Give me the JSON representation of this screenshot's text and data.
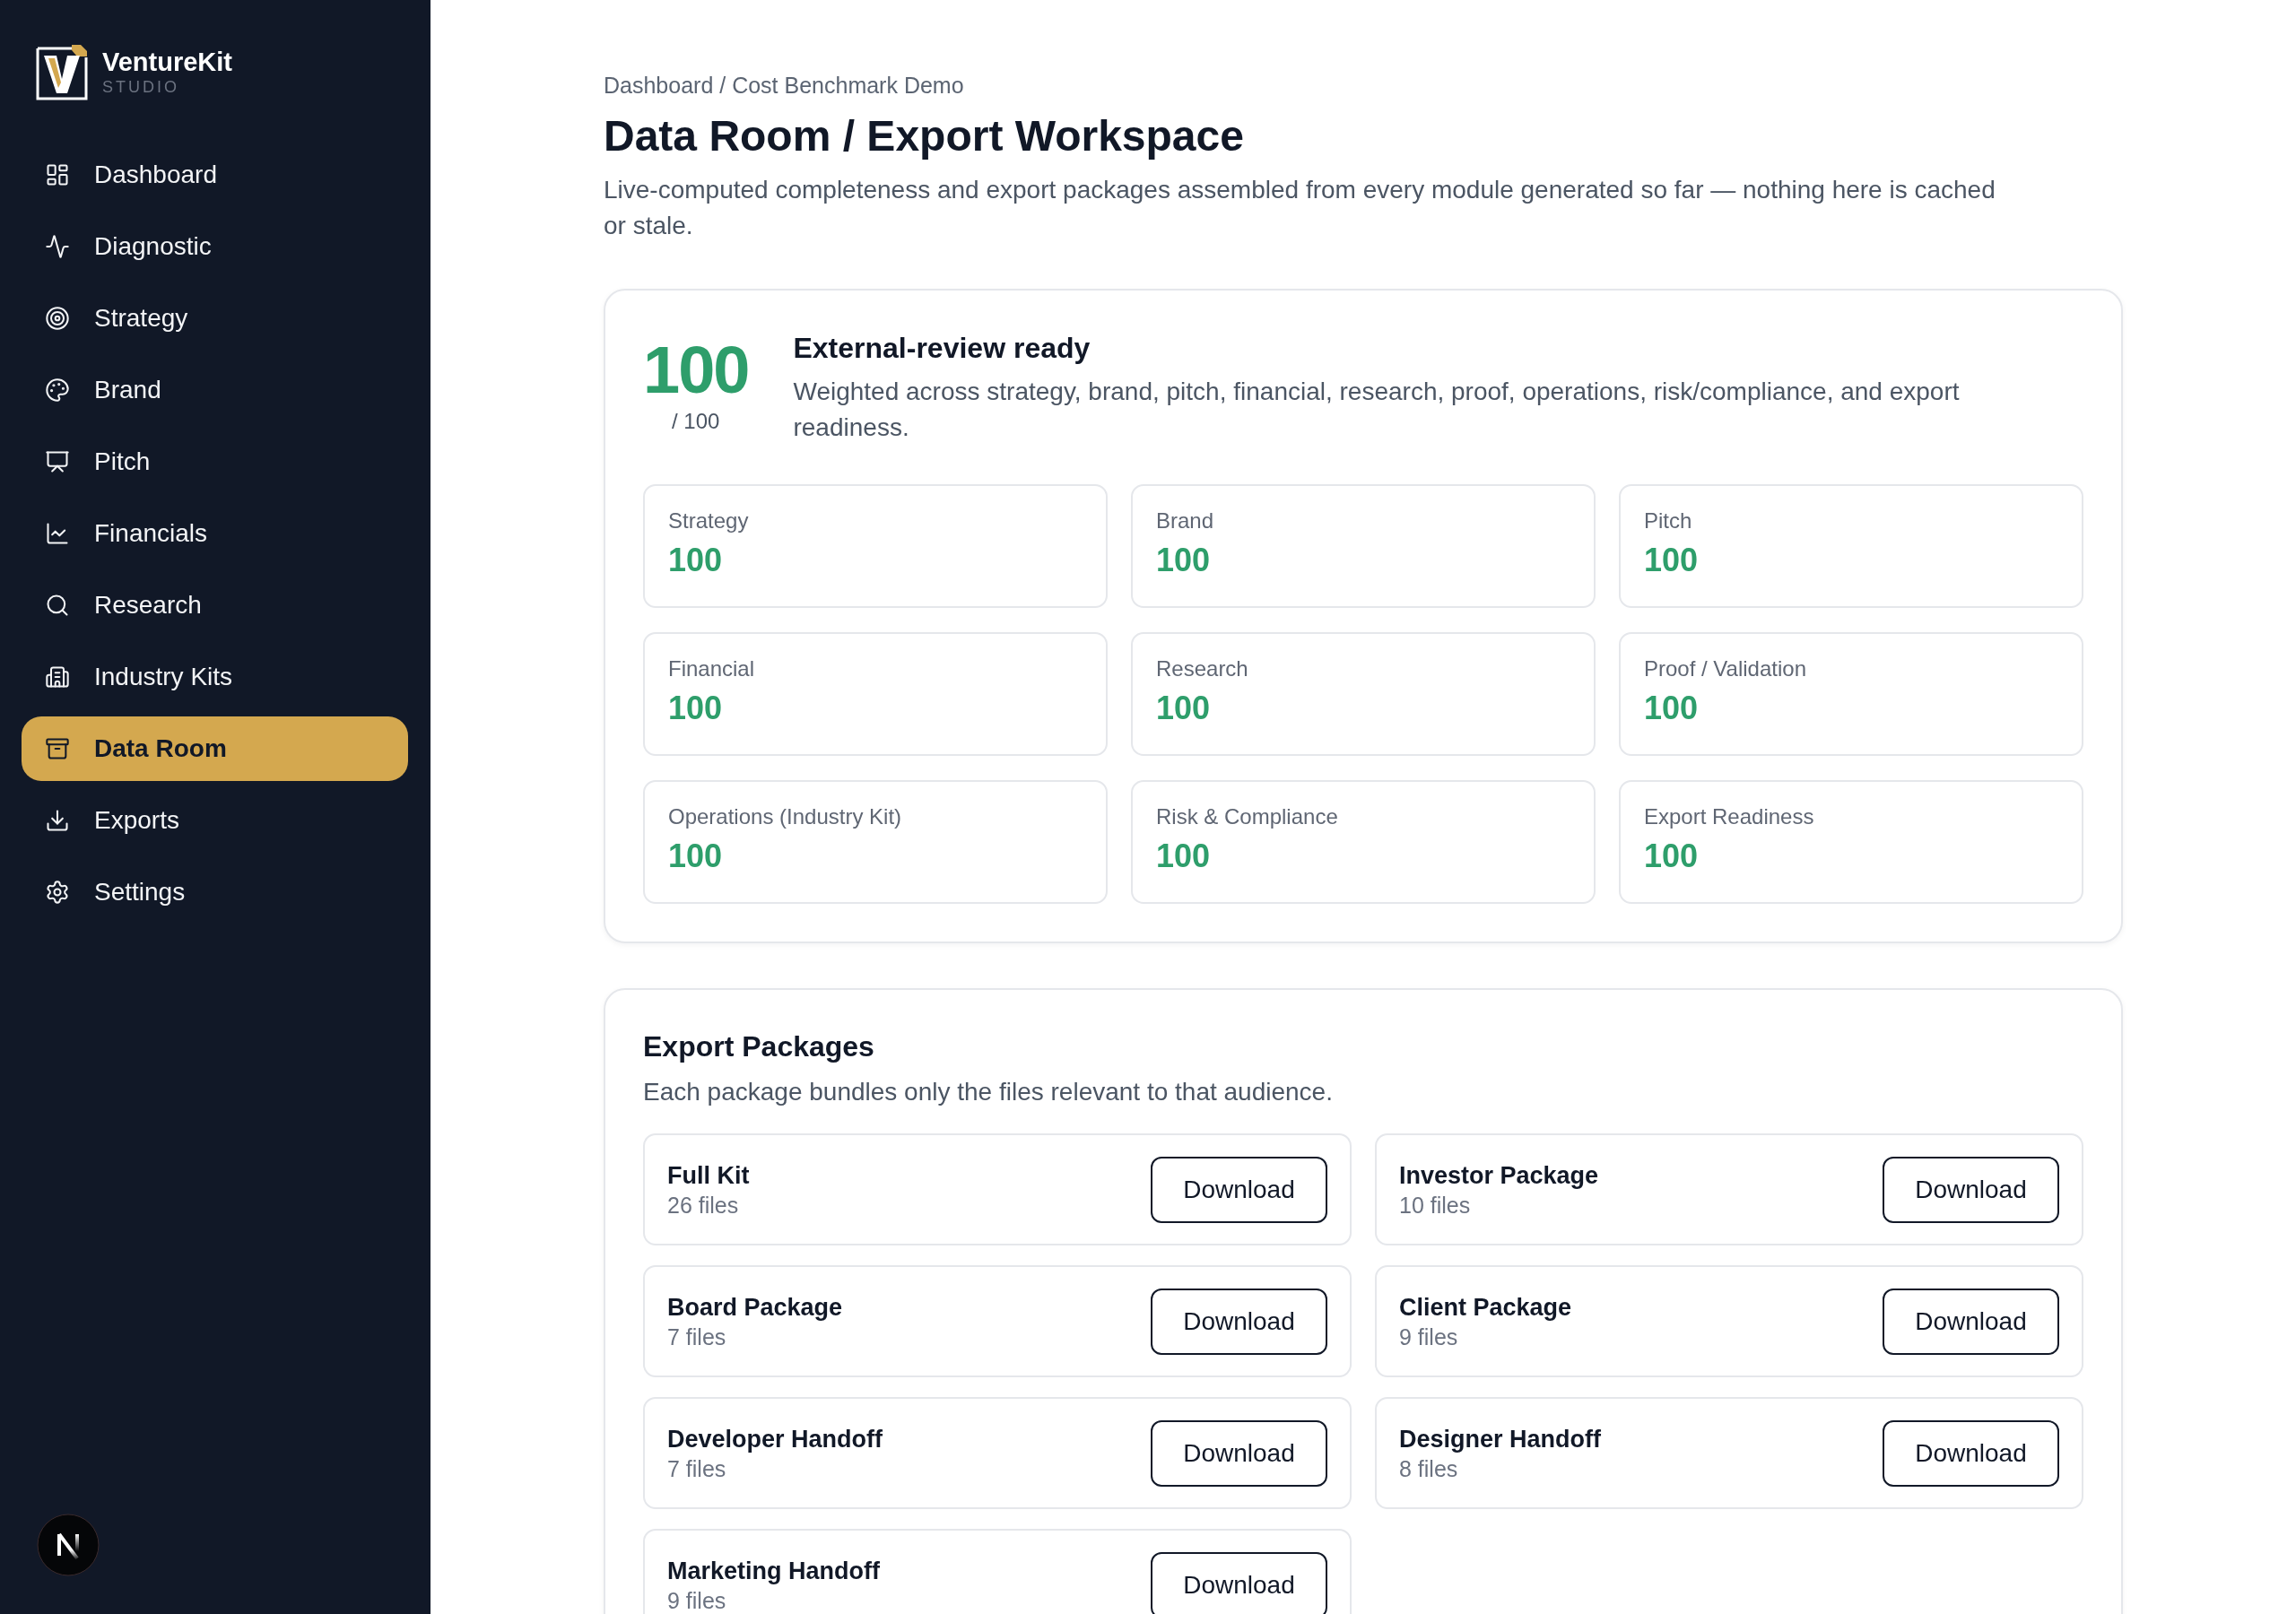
{
  "sidebar": {
    "brand": {
      "name": "VentureKit",
      "tagline": "STUDIO"
    },
    "items": [
      {
        "label": "Dashboard",
        "selected": false
      },
      {
        "label": "Diagnostic",
        "selected": false
      },
      {
        "label": "Strategy",
        "selected": false
      },
      {
        "label": "Brand",
        "selected": false
      },
      {
        "label": "Pitch",
        "selected": false
      },
      {
        "label": "Financials",
        "selected": false
      },
      {
        "label": "Research",
        "selected": false
      },
      {
        "label": "Industry Kits",
        "selected": false
      },
      {
        "label": "Data Room",
        "selected": true
      },
      {
        "label": "Exports",
        "selected": false
      },
      {
        "label": "Settings",
        "selected": false
      }
    ]
  },
  "breadcrumb": "Dashboard / Cost Benchmark Demo",
  "page": {
    "title": "Data Room / Export Workspace",
    "description": "Live-computed completeness and export packages assembled from every module generated so far — nothing here is cached or stale."
  },
  "readiness": {
    "score": "100",
    "max": "/ 100",
    "status": "External-review ready",
    "description": "Weighted across strategy, brand, pitch, financial, research, proof, operations, risk/compliance, and export readiness.",
    "categories": [
      {
        "label": "Strategy",
        "score": "100"
      },
      {
        "label": "Brand",
        "score": "100"
      },
      {
        "label": "Pitch",
        "score": "100"
      },
      {
        "label": "Financial",
        "score": "100"
      },
      {
        "label": "Research",
        "score": "100"
      },
      {
        "label": "Proof / Validation",
        "score": "100"
      },
      {
        "label": "Operations (Industry Kit)",
        "score": "100"
      },
      {
        "label": "Risk & Compliance",
        "score": "100"
      },
      {
        "label": "Export Readiness",
        "score": "100"
      }
    ]
  },
  "export_packages": {
    "title": "Export Packages",
    "description": "Each package bundles only the files relevant to that audience.",
    "packages": [
      {
        "name": "Full Kit",
        "files": "26 files",
        "button": "Download"
      },
      {
        "name": "Investor Package",
        "files": "10 files",
        "button": "Download"
      },
      {
        "name": "Board Package",
        "files": "7 files",
        "button": "Download"
      },
      {
        "name": "Client Package",
        "files": "9 files",
        "button": "Download"
      },
      {
        "name": "Developer Handoff",
        "files": "7 files",
        "button": "Download"
      },
      {
        "name": "Designer Handoff",
        "files": "8 files",
        "button": "Download"
      },
      {
        "name": "Marketing Handoff",
        "files": "9 files",
        "button": "Download"
      }
    ]
  }
}
